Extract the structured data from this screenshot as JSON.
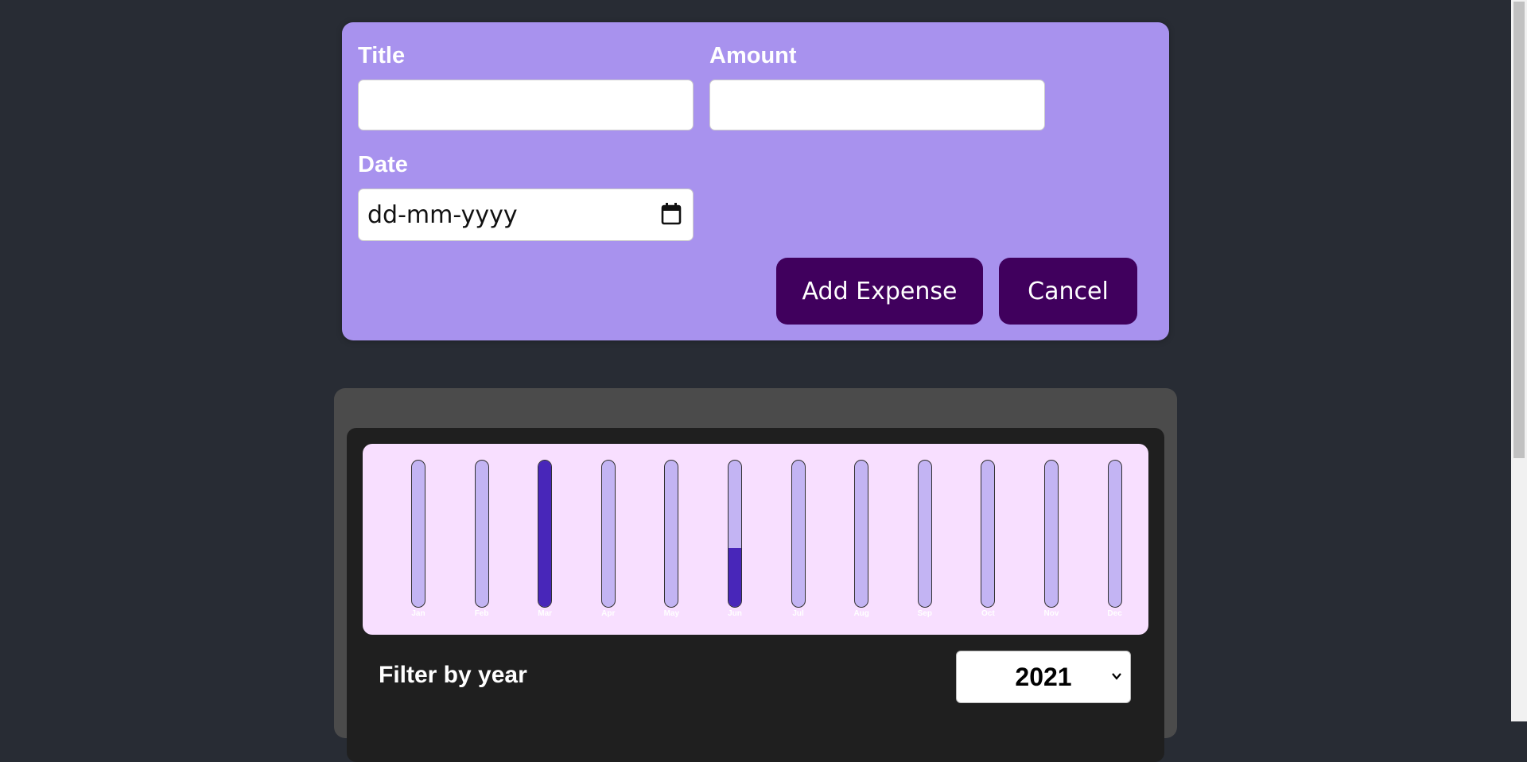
{
  "form": {
    "title_label": "Title",
    "title_value": "",
    "amount_label": "Amount",
    "amount_value": "",
    "date_label": "Date",
    "date_placeholder": "dd-mm-yyyy",
    "date_icon": "calendar-icon",
    "add_button": "Add Expense",
    "cancel_button": "Cancel"
  },
  "colors": {
    "page_background": "#282c34",
    "form_background": "#a892ee",
    "button_background": "#40005d",
    "chart_background": "#f8dfff",
    "bar_track": "#c3b4f3",
    "bar_fill": "#4826b9"
  },
  "chart_data": {
    "type": "bar",
    "categories": [
      "Jan",
      "Feb",
      "Mar",
      "Apr",
      "May",
      "Jun",
      "Jul",
      "Aug",
      "Sep",
      "Oct",
      "Nov",
      "Dec"
    ],
    "values": [
      0,
      0,
      1,
      0,
      0,
      0.4,
      0,
      0,
      0,
      0,
      0,
      0
    ],
    "ylim": [
      0,
      1
    ]
  },
  "filter": {
    "label": "Filter by year",
    "selected_year": "2021",
    "chevron_icon": "chevron-down-icon"
  }
}
